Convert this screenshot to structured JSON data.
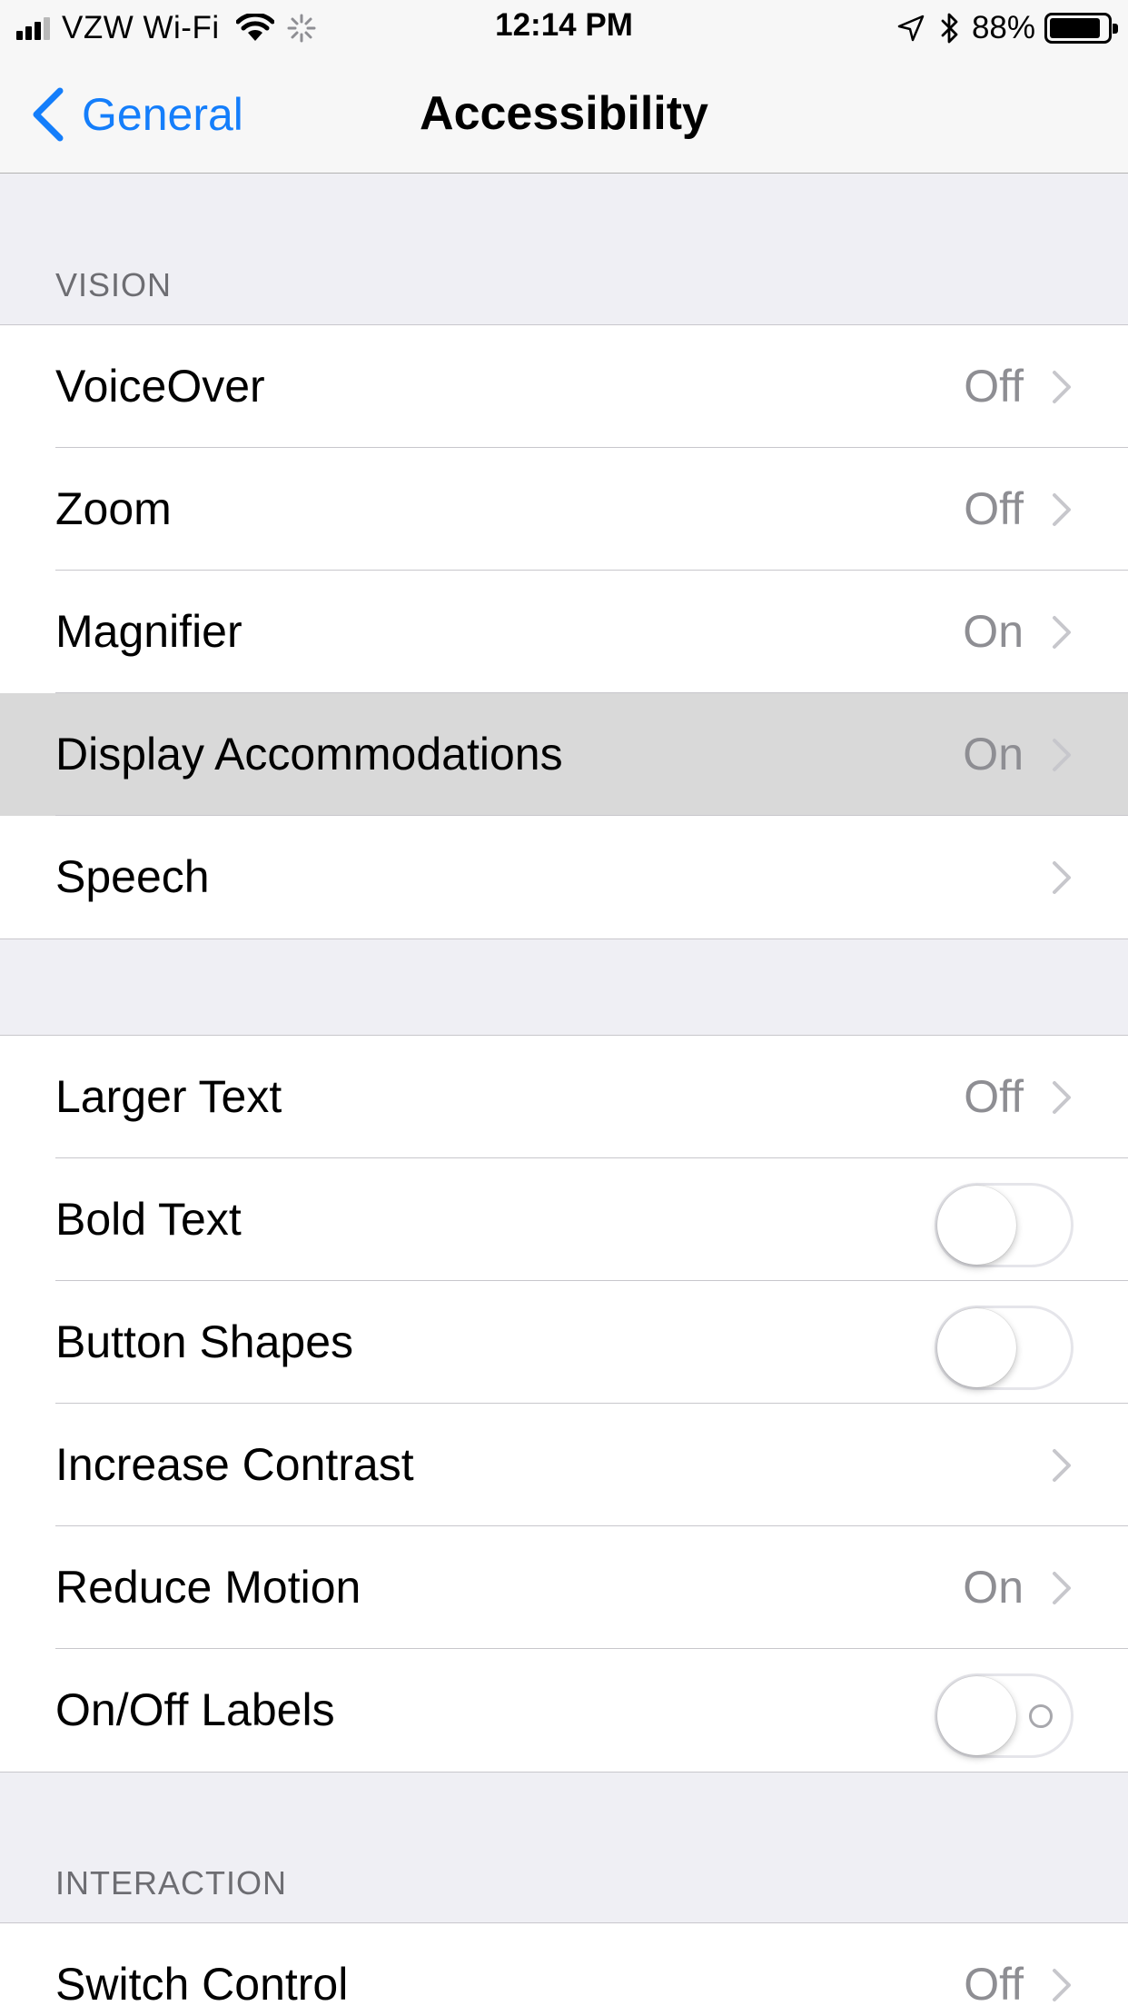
{
  "status_bar": {
    "carrier": "VZW Wi-Fi",
    "time": "12:14 PM",
    "battery_percent": "88%",
    "battery_level": 0.88
  },
  "nav": {
    "back_label": "General",
    "title": "Accessibility"
  },
  "sections": {
    "vision_header": "VISION",
    "interaction_header": "INTERACTION"
  },
  "vision_rows": [
    {
      "label": "VoiceOver",
      "value": "Off"
    },
    {
      "label": "Zoom",
      "value": "Off"
    },
    {
      "label": "Magnifier",
      "value": "On"
    },
    {
      "label": "Display Accommodations",
      "value": "On",
      "highlighted": true
    },
    {
      "label": "Speech",
      "value": ""
    }
  ],
  "display_rows": [
    {
      "label": "Larger Text",
      "value": "Off"
    },
    {
      "label": "Bold Text",
      "toggle": false
    },
    {
      "label": "Button Shapes",
      "toggle": false
    },
    {
      "label": "Increase Contrast",
      "value": ""
    },
    {
      "label": "Reduce Motion",
      "value": "On"
    },
    {
      "label": "On/Off Labels",
      "toggle": false
    }
  ],
  "interaction_rows": [
    {
      "label": "Switch Control",
      "value": "Off"
    }
  ],
  "colors": {
    "accent": "#147efb",
    "background": "#efeff4",
    "highlight": "#d9d9d9",
    "secondary_text": "#8e8e93"
  },
  "icons": {
    "back": "chevron-left-icon",
    "disclosure": "chevron-right-icon",
    "wifi": "wifi-icon",
    "activity": "activity-spinner-icon",
    "location": "location-arrow-icon",
    "bluetooth": "bluetooth-icon",
    "battery": "battery-icon"
  }
}
